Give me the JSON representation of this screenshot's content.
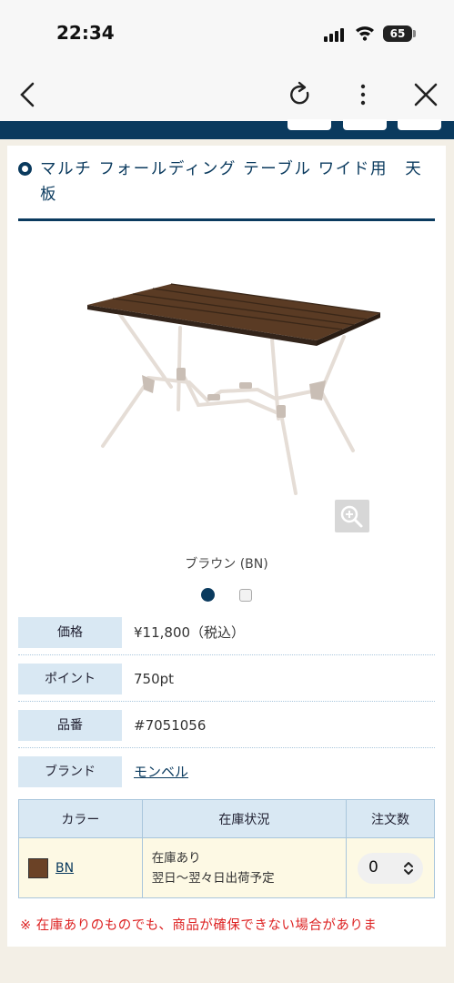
{
  "status_bar": {
    "time": "22:34",
    "battery": "65"
  },
  "colors": {
    "navy": "#0a3a5e",
    "label_bg": "#d9e8f3",
    "stock_bg": "#fdf9e4",
    "notice": "#dd2222",
    "chip": "#6b4226"
  },
  "icons": [
    "back-icon",
    "reload-icon",
    "more-vertical-icon",
    "close-icon",
    "zoom-in-icon",
    "chevron-updown-icon"
  ],
  "product": {
    "title": "マルチ フォールディング テーブル ワイド用　天板",
    "color_caption": "ブラウン (BN)"
  },
  "specs": [
    {
      "label": "価格",
      "value": "¥11,800（税込）"
    },
    {
      "label": "ポイント",
      "value": "750pt"
    },
    {
      "label": "品番",
      "value": "#7051056"
    },
    {
      "label": "ブランド",
      "value": "モンベル"
    }
  ],
  "stock_table": {
    "headers": [
      "カラー",
      "在庫状況",
      "注文数"
    ],
    "rows": [
      {
        "color_code": "BN",
        "stock_line1": "在庫あり",
        "stock_line2": "翌日〜翌々日出荷予定",
        "quantity": "0"
      }
    ]
  },
  "notice": "※ 在庫ありのものでも、商品が確保できない場合がありま"
}
